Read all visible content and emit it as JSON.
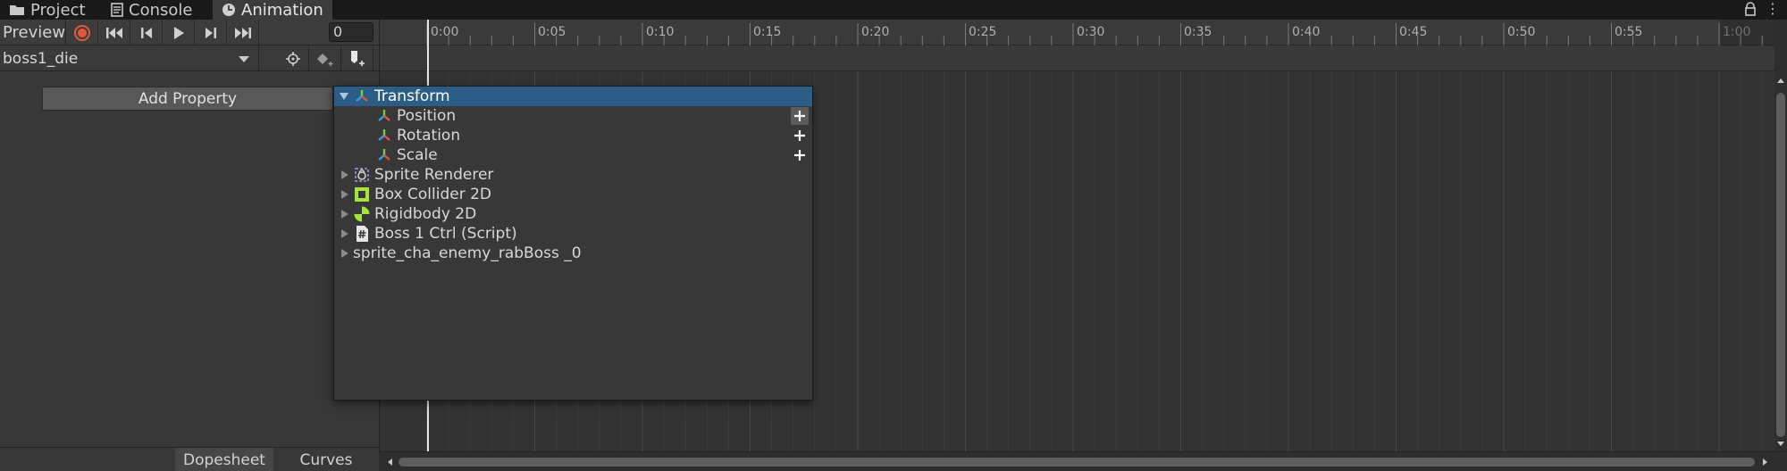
{
  "window_tabs": [
    {
      "label": "Project",
      "icon": "folder-icon"
    },
    {
      "label": "Console",
      "icon": "console-icon"
    },
    {
      "label": "Animation",
      "icon": "clock-icon",
      "active": true
    }
  ],
  "toolbar": {
    "preview_label": "Preview",
    "frame_value": "0",
    "record_color": "#e35a3b"
  },
  "clip": {
    "name": "boss1_die"
  },
  "add_property_label": "Add Property",
  "bottom_tabs": [
    {
      "label": "Dopesheet",
      "active": true
    },
    {
      "label": "Curves",
      "active": false
    }
  ],
  "timeline": {
    "ticks": [
      "0:00",
      "0:05",
      "0:10",
      "0:15",
      "0:20",
      "0:25",
      "0:30",
      "0:35",
      "0:40",
      "0:45",
      "0:50",
      "0:55",
      "1:00"
    ]
  },
  "property_menu": {
    "items": [
      {
        "label": "Transform",
        "icon": "transform-icon",
        "expanded": true,
        "selected": true
      },
      {
        "label": "Position",
        "icon": "transform-icon",
        "child": true,
        "add": true
      },
      {
        "label": "Rotation",
        "icon": "transform-icon",
        "child": true,
        "add": true
      },
      {
        "label": "Scale",
        "icon": "transform-icon",
        "child": true,
        "add": true
      },
      {
        "label": "Sprite Renderer",
        "icon": "sprite-renderer-icon"
      },
      {
        "label": "Box Collider 2D",
        "icon": "box-collider-icon"
      },
      {
        "label": "Rigidbody 2D",
        "icon": "rigidbody-icon"
      },
      {
        "label": "Boss 1 Ctrl (Script)",
        "icon": "script-icon"
      },
      {
        "label": "sprite_cha_enemy_rabBoss _0",
        "icon": ""
      }
    ]
  },
  "accent_colors": {
    "selection": "#2c5d87",
    "component_green": "#a7e33d"
  }
}
